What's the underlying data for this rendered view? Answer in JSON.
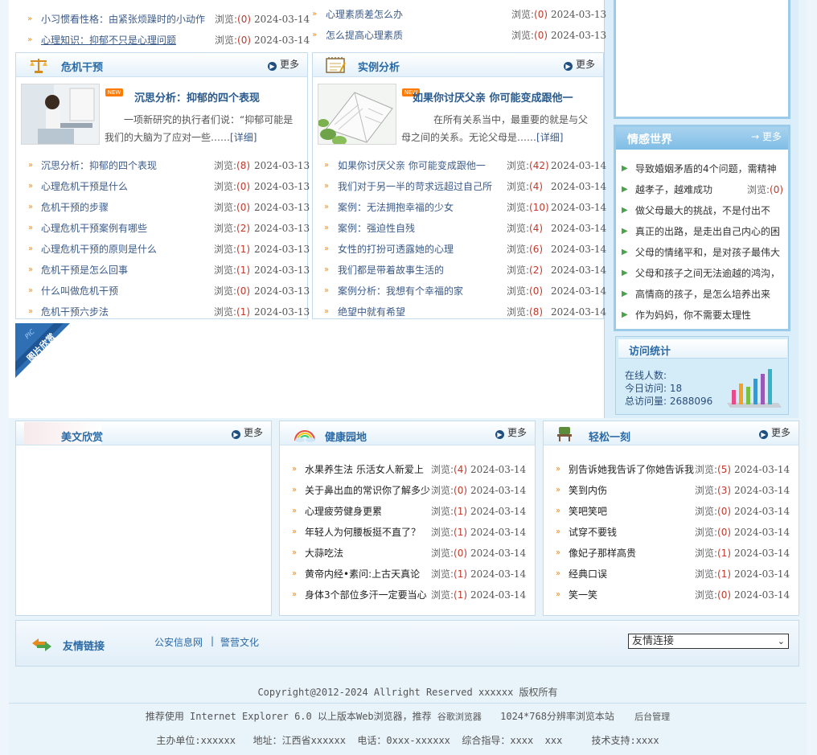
{
  "top_lists": {
    "left": [
      {
        "title": "小习惯看性格：由紧张烦躁时的小动作",
        "views_label": "浏览:",
        "views": "(0)",
        "date": "2024-03-14"
      },
      {
        "title": "心理知识：抑郁不只是心理问题",
        "views_label": "浏览:",
        "views": "(0)",
        "date": "2024-03-14"
      }
    ],
    "right": [
      {
        "title": "心理素质差怎么办",
        "views_label": "浏览:",
        "views": "(0)",
        "date": "2024-03-13"
      },
      {
        "title": "怎么提高心理素质",
        "views_label": "浏览:",
        "views": "(0)",
        "date": "2024-03-13"
      }
    ]
  },
  "crisis": {
    "title": "危机干预",
    "more": "更多",
    "new_badge": "NEW",
    "feature": {
      "title": "沉思分析：抑郁的四个表现",
      "desc": "一项新研究的执行者们说：“抑郁可能是我们的大脑为了应对一些……",
      "detail": "[详细]"
    },
    "items": [
      {
        "title": "沉思分析：抑郁的四个表现",
        "views_label": "浏览:",
        "views": "(8)",
        "date": "2024-03-13"
      },
      {
        "title": "心理危机干预是什么",
        "views_label": "浏览:",
        "views": "(0)",
        "date": "2024-03-13"
      },
      {
        "title": "危机干预的步骤",
        "views_label": "浏览:",
        "views": "(0)",
        "date": "2024-03-13"
      },
      {
        "title": "心理危机干预案例有哪些",
        "views_label": "浏览:",
        "views": "(2)",
        "date": "2024-03-13"
      },
      {
        "title": "心理危机干预的原则是什么",
        "views_label": "浏览:",
        "views": "(1)",
        "date": "2024-03-13"
      },
      {
        "title": "危机干预是怎么回事",
        "views_label": "浏览:",
        "views": "(1)",
        "date": "2024-03-13"
      },
      {
        "title": "什么叫做危机干预",
        "views_label": "浏览:",
        "views": "(0)",
        "date": "2024-03-13"
      },
      {
        "title": "危机干预六步法",
        "views_label": "浏览:",
        "views": "(1)",
        "date": "2024-03-13"
      }
    ]
  },
  "cases": {
    "title": "实例分析",
    "more": "更多",
    "new_badge": "NEW",
    "feature": {
      "title": "如果你讨厌父亲 你可能变成跟他一",
      "desc": "在所有关系当中，最重要的就是与父母之间的关系。无论父母是……",
      "detail": "[详细]"
    },
    "items": [
      {
        "title": "如果你讨厌父亲 你可能变成跟他一",
        "views_label": "浏览:",
        "views": "(42)",
        "date": "2024-03-14"
      },
      {
        "title": "我们对于另一半的苛求远超过自己所",
        "views_label": "浏览:",
        "views": "(4)",
        "date": "2024-03-14"
      },
      {
        "title": "案例：无法拥抱幸福的少女",
        "views_label": "浏览:",
        "views": "(10)",
        "date": "2024-03-14"
      },
      {
        "title": "案例：强迫性自残",
        "views_label": "浏览:",
        "views": "(4)",
        "date": "2024-03-14"
      },
      {
        "title": "女性的打扮可透露她的心理",
        "views_label": "浏览:",
        "views": "(6)",
        "date": "2024-03-14"
      },
      {
        "title": "我们都是带着故事生活的",
        "views_label": "浏览:",
        "views": "(2)",
        "date": "2024-03-14"
      },
      {
        "title": "案例分析：我想有个幸福的家",
        "views_label": "浏览:",
        "views": "(0)",
        "date": "2024-03-14"
      },
      {
        "title": "绝望中就有希望",
        "views_label": "浏览:",
        "views": "(8)",
        "date": "2024-03-14"
      }
    ]
  },
  "gallery": {
    "label": "图片欣赏",
    "tag": "PIC"
  },
  "emotion": {
    "title": "情感世界",
    "more": "更多",
    "items": [
      {
        "title": "导致婚姻矛盾的4个问题，需精神"
      },
      {
        "title": "越孝子，越难成功",
        "views_label": "浏览:",
        "views": "(0)"
      },
      {
        "title": "做父母最大的挑战，不是付出不"
      },
      {
        "title": "真正的出路，是走出自己内心的困"
      },
      {
        "title": "父母的情绪平和，是对孩子最伟大"
      },
      {
        "title": "父母和孩子之间无法逾越的鸿沟，"
      },
      {
        "title": "高情商的孩子，是怎么培养出来"
      },
      {
        "title": "作为妈妈，你不需要太理性"
      }
    ]
  },
  "stats": {
    "title": "访问统计",
    "online_label": "在线人数:",
    "today_label": "今日访问:",
    "today": "18",
    "total_label": "总访问量:",
    "total": "2688096"
  },
  "essay": {
    "title": "美文欣赏",
    "more": "更多"
  },
  "health": {
    "title": "健康园地",
    "more": "更多",
    "items": [
      {
        "title": "水果养生法 乐活女人新爱上",
        "views_label": "浏览:",
        "views": "(4)",
        "date": "2024-03-14"
      },
      {
        "title": "关于鼻出血的常识你了解多少",
        "views_label": "浏览:",
        "views": "(0)",
        "date": "2024-03-14"
      },
      {
        "title": "心理疲劳健身更累",
        "views_label": "浏览:",
        "views": "(1)",
        "date": "2024-03-14"
      },
      {
        "title": "年轻人为何腰板挺不直了？",
        "views_label": "浏览:",
        "views": "(1)",
        "date": "2024-03-14"
      },
      {
        "title": "大蒜吃法",
        "views_label": "浏览:",
        "views": "(0)",
        "date": "2024-03-14"
      },
      {
        "title": "黄帝内经•素问:上古天真论",
        "views_label": "浏览:",
        "views": "(1)",
        "date": "2024-03-14"
      },
      {
        "title": "身体3个部位多汗一定要当心",
        "views_label": "浏览:",
        "views": "(1)",
        "date": "2024-03-14"
      }
    ]
  },
  "relax": {
    "title": "轻松一刻",
    "more": "更多",
    "items": [
      {
        "title": "别告诉她我告诉了你她告诉我",
        "views_label": "浏览:",
        "views": "(5)",
        "date": "2024-03-14"
      },
      {
        "title": "笑到内伤",
        "views_label": "浏览:",
        "views": "(3)",
        "date": "2024-03-14"
      },
      {
        "title": "笑吧笑吧",
        "views_label": "浏览:",
        "views": "(0)",
        "date": "2024-03-14"
      },
      {
        "title": "试穿不要钱",
        "views_label": "浏览:",
        "views": "(0)",
        "date": "2024-03-14"
      },
      {
        "title": "像妃子那样高贵",
        "views_label": "浏览:",
        "views": "(1)",
        "date": "2024-03-14"
      },
      {
        "title": "经典口误",
        "views_label": "浏览:",
        "views": "(1)",
        "date": "2024-03-14"
      },
      {
        "title": "笑一笑",
        "views_label": "浏览:",
        "views": "(0)",
        "date": "2024-03-14"
      }
    ]
  },
  "links": {
    "title": "友情链接",
    "items": [
      "公安信息网",
      "警营文化"
    ],
    "separator": "|",
    "select_value": "友情连接"
  },
  "footer": {
    "copyright": "Copyright@2012-2024 Allright Reserved xxxxxx 版权所有",
    "recommend": "推荐使用  Internet Explorer 6.0  以上版本Web浏览器，推荐",
    "browser_link": "谷歌浏览器",
    "resolution": "1024*768分辨率浏览本站",
    "admin": "后台管理",
    "info": "主办单位:xxxxxx   地址：江西省xxxxxx  电话：0xxx-xxxxxx  综合指导：xxxx  xxx     技术支持:xxxx"
  }
}
